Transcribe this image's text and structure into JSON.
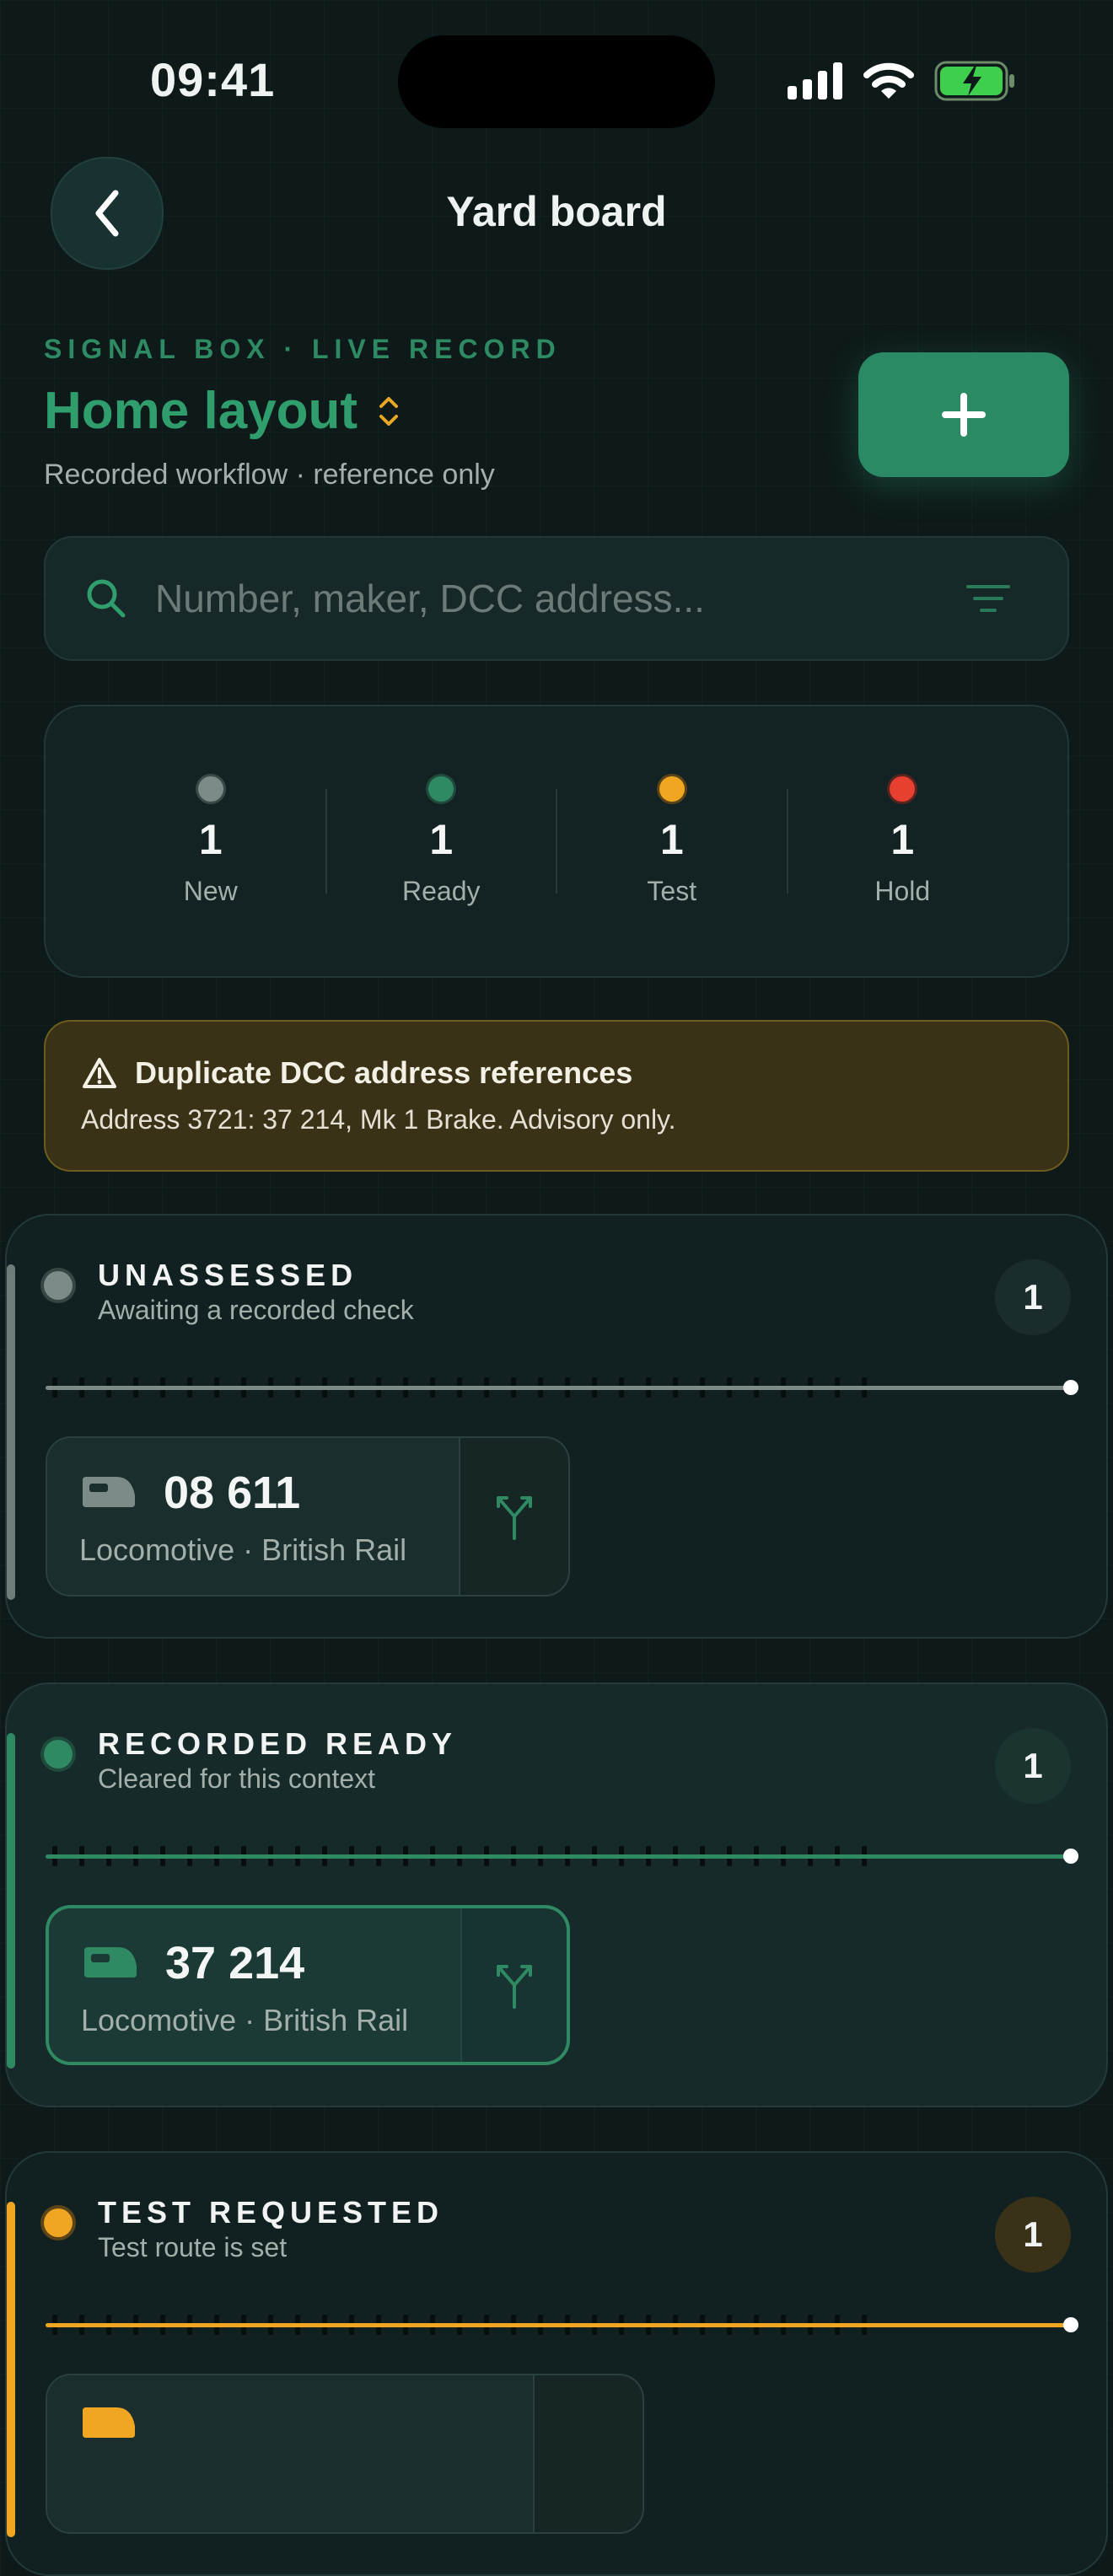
{
  "status_bar": {
    "time": "09:41"
  },
  "nav": {
    "title": "Yard board"
  },
  "header": {
    "eyebrow": "SIGNAL BOX · LIVE RECORD",
    "layout_name": "Home layout",
    "subtitle": "Recorded workflow · reference only"
  },
  "search": {
    "placeholder": "Number, maker, DCC address..."
  },
  "stats": [
    {
      "count": "1",
      "label": "New",
      "color": "#7d8b88"
    },
    {
      "count": "1",
      "label": "Ready",
      "color": "#2f8a63"
    },
    {
      "count": "1",
      "label": "Test",
      "color": "#f0a623"
    },
    {
      "count": "1",
      "label": "Hold",
      "color": "#e8402f"
    }
  ],
  "warning": {
    "title": "Duplicate DCC address references",
    "body": "Address 3721: 37 214, Mk 1 Brake. Advisory only."
  },
  "sections": [
    {
      "title": "UNASSESSED",
      "subtitle": "Awaiting a recorded check",
      "count": "1",
      "color": "#7d8b88",
      "card": {
        "number": "08 611",
        "type": "Locomotive · British Rail"
      }
    },
    {
      "title": "RECORDED READY",
      "subtitle": "Cleared for this context",
      "count": "1",
      "color": "#2f8a63",
      "card": {
        "number": "37 214",
        "type": "Locomotive · British Rail"
      }
    },
    {
      "title": "TEST REQUESTED",
      "subtitle": "Test route is set",
      "count": "1",
      "color": "#f0a623"
    }
  ]
}
